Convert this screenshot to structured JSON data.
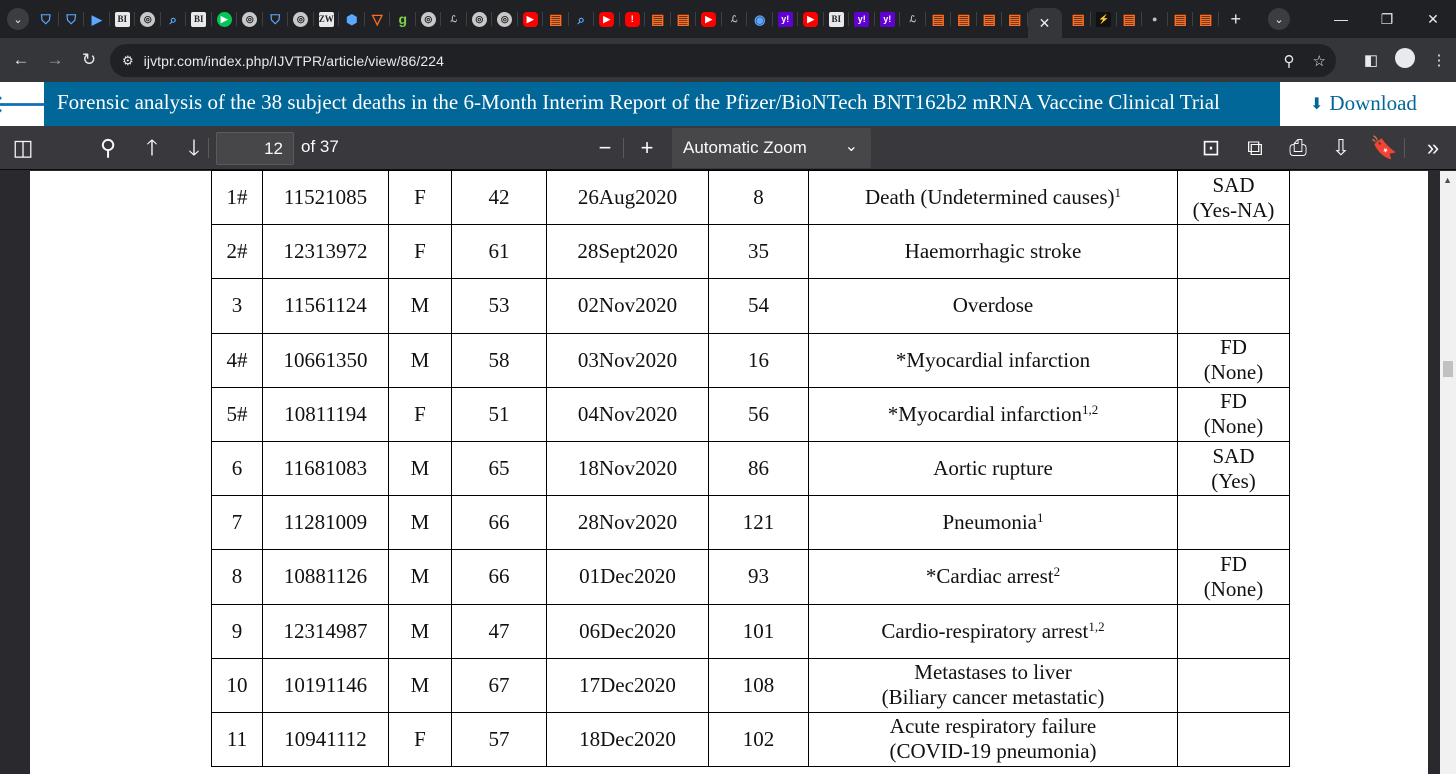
{
  "browser": {
    "url": "ijvtpr.com/index.php/IJVTPR/article/view/86/224",
    "tab_favicons": [
      {
        "icon": "shield-icon",
        "style": "fav-shield",
        "glyph": "⛉"
      },
      {
        "icon": "shield-icon",
        "style": "fav-shield",
        "glyph": "⛉"
      },
      {
        "icon": "document-icon",
        "style": "fav-blue",
        "glyph": "▶"
      },
      {
        "icon": "bi-logo-icon",
        "style": "fav-bi",
        "glyph": "BI"
      },
      {
        "icon": "globe-icon",
        "style": "fav-ring",
        "glyph": "◎"
      },
      {
        "icon": "search-icon",
        "style": "fav-blue",
        "glyph": "⌕"
      },
      {
        "icon": "bi-logo-icon",
        "style": "fav-bi",
        "glyph": "BI"
      },
      {
        "icon": "play-icon",
        "style": "fav-play",
        "glyph": "▶"
      },
      {
        "icon": "globe-icon",
        "style": "fav-ring",
        "glyph": "◎"
      },
      {
        "icon": "shield-icon",
        "style": "fav-shield",
        "glyph": "⛉"
      },
      {
        "icon": "globe-icon",
        "style": "fav-ring",
        "glyph": "◎"
      },
      {
        "icon": "news-icon",
        "style": "fav-bi",
        "glyph": "ZW"
      },
      {
        "icon": "hexagon-icon",
        "style": "fav-blue",
        "glyph": "⬢"
      },
      {
        "icon": "brave-icon",
        "style": "fav-sub",
        "glyph": "▽"
      },
      {
        "icon": "g-logo-icon",
        "style": "fav-green",
        "glyph": "g"
      },
      {
        "icon": "globe-icon",
        "style": "fav-ring",
        "glyph": "◎"
      },
      {
        "icon": "journal-icon",
        "style": "fav-gray",
        "glyph": "ℒ"
      },
      {
        "icon": "globe-icon",
        "style": "fav-ring",
        "glyph": "◎"
      },
      {
        "icon": "globe-icon",
        "style": "fav-ring",
        "glyph": "◎"
      },
      {
        "icon": "youtube-icon",
        "style": "fav-red",
        "glyph": "▶"
      },
      {
        "icon": "substack-icon",
        "style": "fav-sub",
        "glyph": "▤"
      },
      {
        "icon": "search-icon",
        "style": "fav-blue",
        "glyph": "⌕"
      },
      {
        "icon": "youtube-icon",
        "style": "fav-red",
        "glyph": "▶"
      },
      {
        "icon": "alert-icon",
        "style": "fav-red",
        "glyph": "!"
      },
      {
        "icon": "substack-icon",
        "style": "fav-sub",
        "glyph": "▤"
      },
      {
        "icon": "substack-icon",
        "style": "fav-sub",
        "glyph": "▤"
      },
      {
        "icon": "youtube-icon",
        "style": "fav-red",
        "glyph": "▶"
      },
      {
        "icon": "journal-icon",
        "style": "fav-gray",
        "glyph": "ℒ"
      },
      {
        "icon": "c-logo-icon",
        "style": "fav-blue",
        "glyph": "◉"
      },
      {
        "icon": "yahoo-icon",
        "style": "fav-yahoo",
        "glyph": "y!"
      },
      {
        "icon": "youtube-icon",
        "style": "fav-red",
        "glyph": "▶"
      },
      {
        "icon": "bi-logo-icon",
        "style": "fav-bi",
        "glyph": "BI"
      },
      {
        "icon": "yahoo-icon",
        "style": "fav-yahoo",
        "glyph": "y!"
      },
      {
        "icon": "yahoo-icon",
        "style": "fav-yahoo",
        "glyph": "y!"
      },
      {
        "icon": "journal-icon",
        "style": "fav-gray",
        "glyph": "ℒ"
      },
      {
        "icon": "substack-icon",
        "style": "fav-sub",
        "glyph": "▤"
      },
      {
        "icon": "substack-icon",
        "style": "fav-sub",
        "glyph": "▤"
      },
      {
        "icon": "substack-icon",
        "style": "fav-sub",
        "glyph": "▤"
      },
      {
        "icon": "substack-icon",
        "style": "fav-sub",
        "glyph": "▤"
      }
    ],
    "tab_favicons_after": [
      {
        "icon": "substack-icon",
        "style": "fav-sub",
        "glyph": "▤"
      },
      {
        "icon": "lightning-icon",
        "style": "fav-dark",
        "glyph": "⚡"
      },
      {
        "icon": "substack-icon",
        "style": "fav-sub",
        "glyph": "▤"
      },
      {
        "icon": "dark-globe-icon",
        "style": "fav-gray",
        "glyph": "●"
      },
      {
        "icon": "substack-icon",
        "style": "fav-sub",
        "glyph": "▤"
      },
      {
        "icon": "substack-icon",
        "style": "fav-sub",
        "glyph": "▤"
      }
    ],
    "active_tab_close": "✕",
    "new_tab": "+",
    "colors": {
      "tabstrip": "#202124",
      "toolbar": "#35363a"
    }
  },
  "article": {
    "back_arrow": "🡐",
    "title": "Forensic analysis of the 38 subject deaths in the 6-Month Interim Report of the Pfizer/BioNTech BNT162b2 mRNA Vaccine Clinical Trial",
    "download_label": "Download",
    "accent_color": "#006798"
  },
  "pdf_toolbar": {
    "page_number": "12",
    "page_count": "of 37",
    "zoom": "Automatic Zoom"
  },
  "deaths_table": {
    "rows": [
      {
        "cells": [
          "1#",
          "11521085",
          "F",
          "42",
          "26Aug2020",
          "8"
        ],
        "event": "Death (Undetermined causes)",
        "event_sup": "1",
        "event_line2": "",
        "class_l1": "SAD",
        "class_l2": "(Yes-NA)"
      },
      {
        "cells": [
          "2#",
          "12313972",
          "F",
          "61",
          "28Sept2020",
          "35"
        ],
        "event": "Haemorrhagic stroke",
        "event_sup": "",
        "event_line2": "",
        "class_l1": "",
        "class_l2": ""
      },
      {
        "cells": [
          "3",
          "11561124",
          "M",
          "53",
          "02Nov2020",
          "54"
        ],
        "event": "Overdose",
        "event_sup": "",
        "event_line2": "",
        "class_l1": "",
        "class_l2": ""
      },
      {
        "cells": [
          "4#",
          "10661350",
          "M",
          "58",
          "03Nov2020",
          "16"
        ],
        "event": "*Myocardial infarction",
        "event_sup": "",
        "event_line2": "",
        "class_l1": "FD",
        "class_l2": "(None)"
      },
      {
        "cells": [
          "5#",
          "10811194",
          "F",
          "51",
          "04Nov2020",
          "56"
        ],
        "event": "*Myocardial infarction",
        "event_sup": "1,2",
        "event_line2": "",
        "class_l1": "FD",
        "class_l2": "(None)"
      },
      {
        "cells": [
          "6",
          "11681083",
          "M",
          "65",
          "18Nov2020",
          "86"
        ],
        "event": "Aortic rupture",
        "event_sup": "",
        "event_line2": "",
        "class_l1": "SAD",
        "class_l2": "(Yes)"
      },
      {
        "cells": [
          "7",
          "11281009",
          "M",
          "66",
          "28Nov2020",
          "121"
        ],
        "event": "Pneumonia",
        "event_sup": "1",
        "event_line2": "",
        "class_l1": "",
        "class_l2": ""
      },
      {
        "cells": [
          "8",
          "10881126",
          "M",
          "66",
          "01Dec2020",
          "93"
        ],
        "event": "*Cardiac arrest",
        "event_sup": "2",
        "event_line2": "",
        "class_l1": "FD",
        "class_l2": "(None)"
      },
      {
        "cells": [
          "9",
          "12314987",
          "M",
          "47",
          "06Dec2020",
          "101"
        ],
        "event": "Cardio-respiratory arrest",
        "event_sup": "1,2",
        "event_line2": "",
        "class_l1": "",
        "class_l2": ""
      },
      {
        "cells": [
          "10",
          "10191146",
          "M",
          "67",
          "17Dec2020",
          "108"
        ],
        "event": "Metastases to liver",
        "event_sup": "",
        "event_line2": "(Biliary cancer metastatic)",
        "class_l1": "",
        "class_l2": ""
      },
      {
        "cells": [
          "11",
          "10941112",
          "F",
          "57",
          "18Dec2020",
          "102"
        ],
        "event": "Acute respiratory failure",
        "event_sup": "",
        "event_line2": "(COVID-19 pneumonia)",
        "class_l1": "",
        "class_l2": ""
      }
    ]
  }
}
